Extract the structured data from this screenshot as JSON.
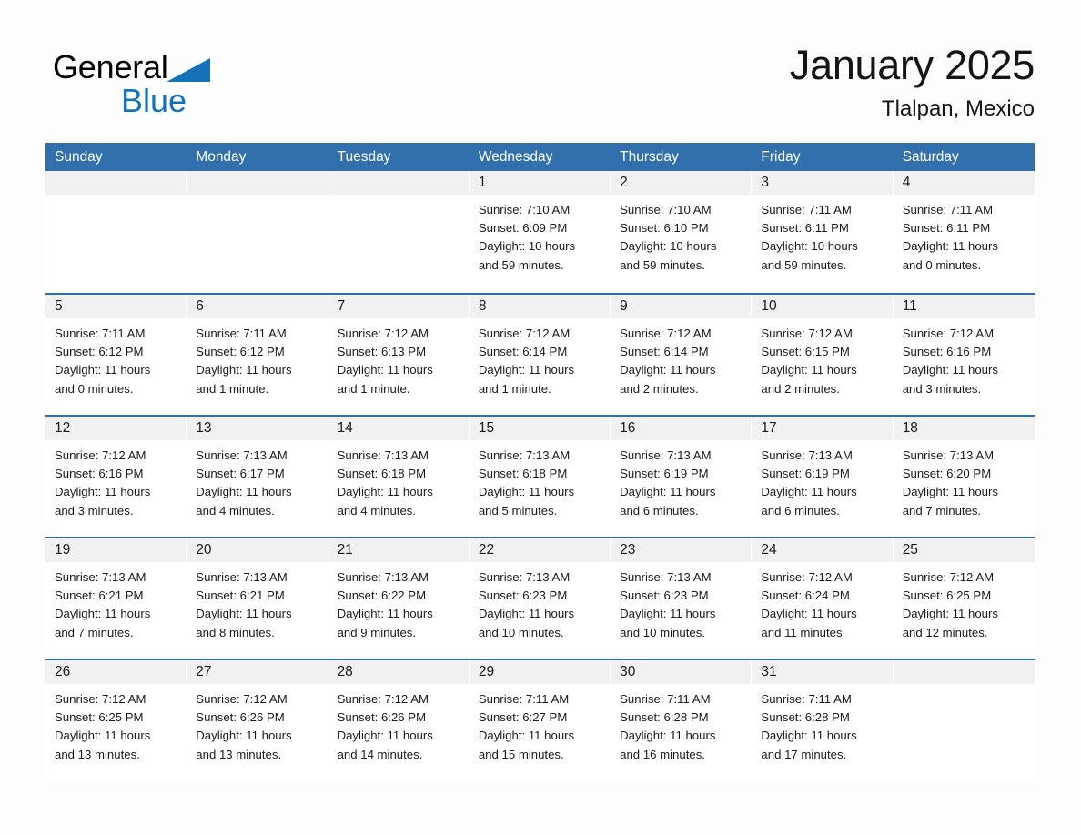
{
  "brand": {
    "name_part1": "General",
    "name_part2": "Blue",
    "triangle_color": "#1473b8"
  },
  "header": {
    "title": "January 2025",
    "subtitle": "Tlalpan, Mexico"
  },
  "theme": {
    "header_blue": "#3170ad",
    "row_rule_blue": "#2f6fad",
    "daynum_strip": "#f1f1f1",
    "page_background": "#fdfdfd"
  },
  "weekdays": [
    "Sunday",
    "Monday",
    "Tuesday",
    "Wednesday",
    "Thursday",
    "Friday",
    "Saturday"
  ],
  "weeks": [
    [
      {
        "day": "",
        "sunrise": "",
        "sunset": "",
        "daylight_line1": "",
        "daylight_line2": ""
      },
      {
        "day": "",
        "sunrise": "",
        "sunset": "",
        "daylight_line1": "",
        "daylight_line2": ""
      },
      {
        "day": "",
        "sunrise": "",
        "sunset": "",
        "daylight_line1": "",
        "daylight_line2": ""
      },
      {
        "day": "1",
        "sunrise": "Sunrise: 7:10 AM",
        "sunset": "Sunset: 6:09 PM",
        "daylight_line1": "Daylight: 10 hours",
        "daylight_line2": "and 59 minutes."
      },
      {
        "day": "2",
        "sunrise": "Sunrise: 7:10 AM",
        "sunset": "Sunset: 6:10 PM",
        "daylight_line1": "Daylight: 10 hours",
        "daylight_line2": "and 59 minutes."
      },
      {
        "day": "3",
        "sunrise": "Sunrise: 7:11 AM",
        "sunset": "Sunset: 6:11 PM",
        "daylight_line1": "Daylight: 10 hours",
        "daylight_line2": "and 59 minutes."
      },
      {
        "day": "4",
        "sunrise": "Sunrise: 7:11 AM",
        "sunset": "Sunset: 6:11 PM",
        "daylight_line1": "Daylight: 11 hours",
        "daylight_line2": "and 0 minutes."
      }
    ],
    [
      {
        "day": "5",
        "sunrise": "Sunrise: 7:11 AM",
        "sunset": "Sunset: 6:12 PM",
        "daylight_line1": "Daylight: 11 hours",
        "daylight_line2": "and 0 minutes."
      },
      {
        "day": "6",
        "sunrise": "Sunrise: 7:11 AM",
        "sunset": "Sunset: 6:12 PM",
        "daylight_line1": "Daylight: 11 hours",
        "daylight_line2": "and 1 minute."
      },
      {
        "day": "7",
        "sunrise": "Sunrise: 7:12 AM",
        "sunset": "Sunset: 6:13 PM",
        "daylight_line1": "Daylight: 11 hours",
        "daylight_line2": "and 1 minute."
      },
      {
        "day": "8",
        "sunrise": "Sunrise: 7:12 AM",
        "sunset": "Sunset: 6:14 PM",
        "daylight_line1": "Daylight: 11 hours",
        "daylight_line2": "and 1 minute."
      },
      {
        "day": "9",
        "sunrise": "Sunrise: 7:12 AM",
        "sunset": "Sunset: 6:14 PM",
        "daylight_line1": "Daylight: 11 hours",
        "daylight_line2": "and 2 minutes."
      },
      {
        "day": "10",
        "sunrise": "Sunrise: 7:12 AM",
        "sunset": "Sunset: 6:15 PM",
        "daylight_line1": "Daylight: 11 hours",
        "daylight_line2": "and 2 minutes."
      },
      {
        "day": "11",
        "sunrise": "Sunrise: 7:12 AM",
        "sunset": "Sunset: 6:16 PM",
        "daylight_line1": "Daylight: 11 hours",
        "daylight_line2": "and 3 minutes."
      }
    ],
    [
      {
        "day": "12",
        "sunrise": "Sunrise: 7:12 AM",
        "sunset": "Sunset: 6:16 PM",
        "daylight_line1": "Daylight: 11 hours",
        "daylight_line2": "and 3 minutes."
      },
      {
        "day": "13",
        "sunrise": "Sunrise: 7:13 AM",
        "sunset": "Sunset: 6:17 PM",
        "daylight_line1": "Daylight: 11 hours",
        "daylight_line2": "and 4 minutes."
      },
      {
        "day": "14",
        "sunrise": "Sunrise: 7:13 AM",
        "sunset": "Sunset: 6:18 PM",
        "daylight_line1": "Daylight: 11 hours",
        "daylight_line2": "and 4 minutes."
      },
      {
        "day": "15",
        "sunrise": "Sunrise: 7:13 AM",
        "sunset": "Sunset: 6:18 PM",
        "daylight_line1": "Daylight: 11 hours",
        "daylight_line2": "and 5 minutes."
      },
      {
        "day": "16",
        "sunrise": "Sunrise: 7:13 AM",
        "sunset": "Sunset: 6:19 PM",
        "daylight_line1": "Daylight: 11 hours",
        "daylight_line2": "and 6 minutes."
      },
      {
        "day": "17",
        "sunrise": "Sunrise: 7:13 AM",
        "sunset": "Sunset: 6:19 PM",
        "daylight_line1": "Daylight: 11 hours",
        "daylight_line2": "and 6 minutes."
      },
      {
        "day": "18",
        "sunrise": "Sunrise: 7:13 AM",
        "sunset": "Sunset: 6:20 PM",
        "daylight_line1": "Daylight: 11 hours",
        "daylight_line2": "and 7 minutes."
      }
    ],
    [
      {
        "day": "19",
        "sunrise": "Sunrise: 7:13 AM",
        "sunset": "Sunset: 6:21 PM",
        "daylight_line1": "Daylight: 11 hours",
        "daylight_line2": "and 7 minutes."
      },
      {
        "day": "20",
        "sunrise": "Sunrise: 7:13 AM",
        "sunset": "Sunset: 6:21 PM",
        "daylight_line1": "Daylight: 11 hours",
        "daylight_line2": "and 8 minutes."
      },
      {
        "day": "21",
        "sunrise": "Sunrise: 7:13 AM",
        "sunset": "Sunset: 6:22 PM",
        "daylight_line1": "Daylight: 11 hours",
        "daylight_line2": "and 9 minutes."
      },
      {
        "day": "22",
        "sunrise": "Sunrise: 7:13 AM",
        "sunset": "Sunset: 6:23 PM",
        "daylight_line1": "Daylight: 11 hours",
        "daylight_line2": "and 10 minutes."
      },
      {
        "day": "23",
        "sunrise": "Sunrise: 7:13 AM",
        "sunset": "Sunset: 6:23 PM",
        "daylight_line1": "Daylight: 11 hours",
        "daylight_line2": "and 10 minutes."
      },
      {
        "day": "24",
        "sunrise": "Sunrise: 7:12 AM",
        "sunset": "Sunset: 6:24 PM",
        "daylight_line1": "Daylight: 11 hours",
        "daylight_line2": "and 11 minutes."
      },
      {
        "day": "25",
        "sunrise": "Sunrise: 7:12 AM",
        "sunset": "Sunset: 6:25 PM",
        "daylight_line1": "Daylight: 11 hours",
        "daylight_line2": "and 12 minutes."
      }
    ],
    [
      {
        "day": "26",
        "sunrise": "Sunrise: 7:12 AM",
        "sunset": "Sunset: 6:25 PM",
        "daylight_line1": "Daylight: 11 hours",
        "daylight_line2": "and 13 minutes."
      },
      {
        "day": "27",
        "sunrise": "Sunrise: 7:12 AM",
        "sunset": "Sunset: 6:26 PM",
        "daylight_line1": "Daylight: 11 hours",
        "daylight_line2": "and 13 minutes."
      },
      {
        "day": "28",
        "sunrise": "Sunrise: 7:12 AM",
        "sunset": "Sunset: 6:26 PM",
        "daylight_line1": "Daylight: 11 hours",
        "daylight_line2": "and 14 minutes."
      },
      {
        "day": "29",
        "sunrise": "Sunrise: 7:11 AM",
        "sunset": "Sunset: 6:27 PM",
        "daylight_line1": "Daylight: 11 hours",
        "daylight_line2": "and 15 minutes."
      },
      {
        "day": "30",
        "sunrise": "Sunrise: 7:11 AM",
        "sunset": "Sunset: 6:28 PM",
        "daylight_line1": "Daylight: 11 hours",
        "daylight_line2": "and 16 minutes."
      },
      {
        "day": "31",
        "sunrise": "Sunrise: 7:11 AM",
        "sunset": "Sunset: 6:28 PM",
        "daylight_line1": "Daylight: 11 hours",
        "daylight_line2": "and 17 minutes."
      },
      {
        "day": "",
        "sunrise": "",
        "sunset": "",
        "daylight_line1": "",
        "daylight_line2": ""
      }
    ]
  ]
}
